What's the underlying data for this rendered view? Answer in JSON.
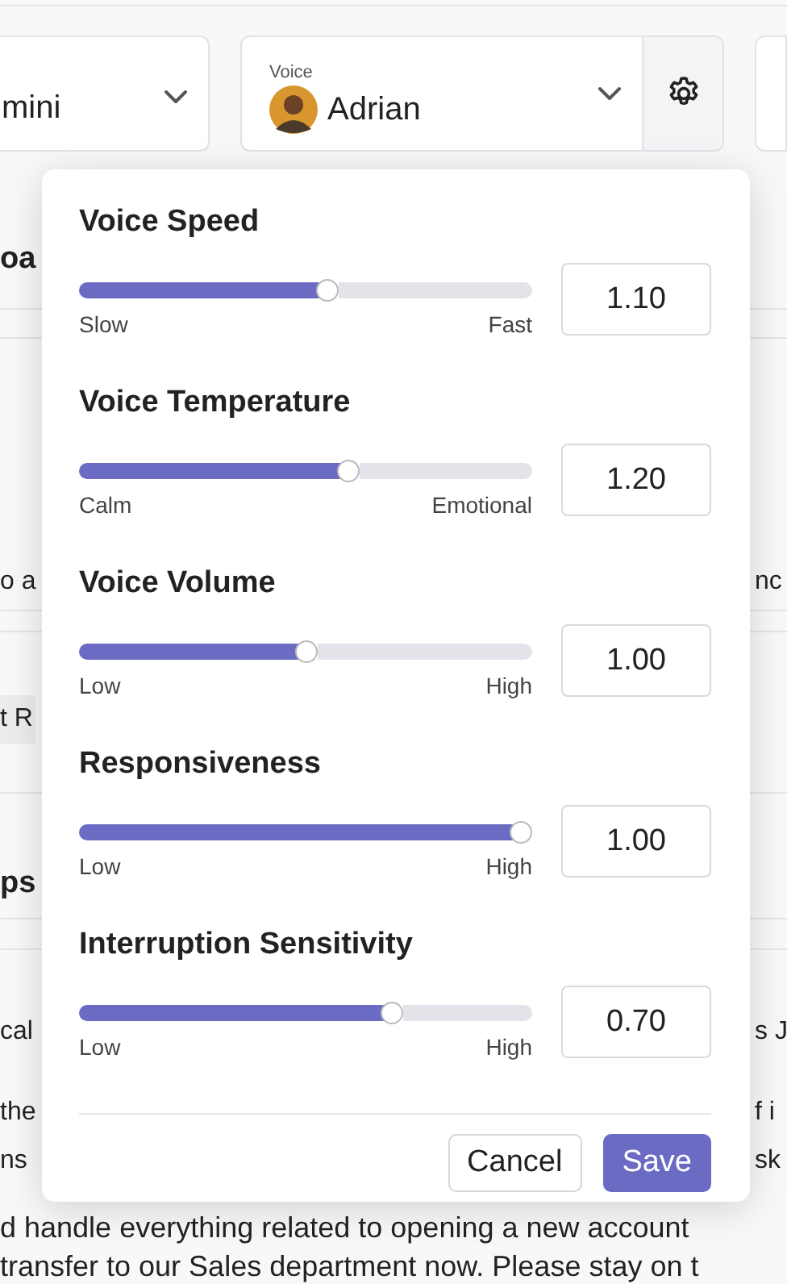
{
  "selectors": [
    {
      "value": "mini"
    },
    {
      "label": "Voice",
      "value": "Adrian"
    }
  ],
  "background": [
    {
      "kind": "heading",
      "left": "oa"
    },
    {
      "kind": "text",
      "left": "o a",
      "right": "nc"
    },
    {
      "kind": "chip",
      "left": "t R"
    },
    {
      "kind": "heading",
      "left": "ps"
    },
    {
      "kind": "split",
      "left": "cal",
      "right": "s J"
    },
    {
      "kind": "split",
      "left": "the",
      "right": "f i"
    },
    {
      "kind": "split",
      "left": "ns",
      "right": "sk"
    },
    {
      "kind": "line",
      "left": "d handle everything related to opening a new account"
    },
    {
      "kind": "line",
      "left": "transfer to our Sales department now. Please stay on t"
    }
  ],
  "voice_settings": {
    "sliders": [
      {
        "title": "Voice Speed",
        "level": 0.55,
        "min_label": "Slow",
        "max_label": "Fast",
        "value": "1.10"
      },
      {
        "title": "Voice Temperature",
        "level": 0.6,
        "min_label": "Calm",
        "max_label": "Emotional",
        "value": "1.20"
      },
      {
        "title": "Voice Volume",
        "level": 0.5,
        "min_label": "Low",
        "max_label": "High",
        "value": "1.00"
      },
      {
        "title": "Responsiveness",
        "level": 1.0,
        "min_label": "Low",
        "max_label": "High",
        "value": "1.00"
      },
      {
        "title": "Interruption Sensitivity",
        "level": 0.7,
        "min_label": "Low",
        "max_label": "High",
        "value": "0.70"
      }
    ],
    "buttons": [
      {
        "label": "Cancel",
        "kind": "secondary"
      },
      {
        "label": "Save",
        "kind": "primary"
      }
    ]
  }
}
